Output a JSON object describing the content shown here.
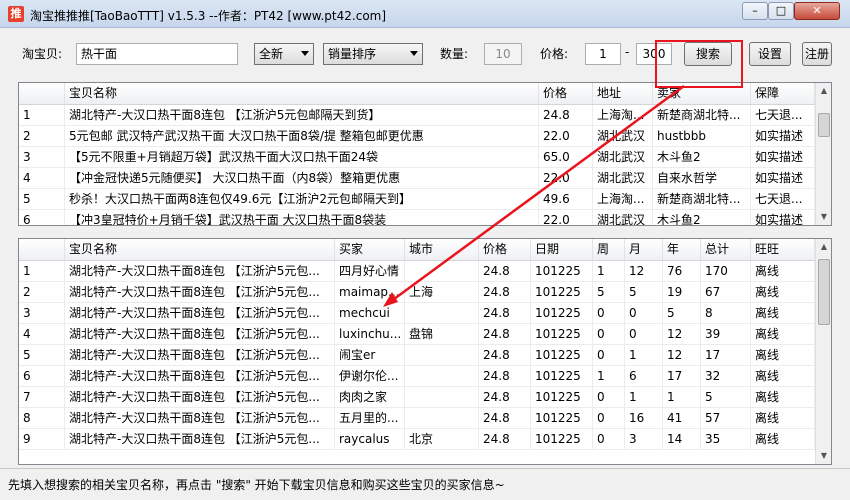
{
  "window": {
    "app_icon_glyph": "推",
    "title": "淘宝推推推[TaoBaoTTT] v1.5.3 --作者：PT42 [www.pt42.com]",
    "minimize_glyph": "–",
    "maximize_glyph": "□",
    "close_glyph": "✕"
  },
  "toolbar": {
    "keyword_label": "淘宝贝:",
    "keyword_value": "热干面",
    "condition_value": "全新",
    "sort_value": "销量排序",
    "count_label": "数量:",
    "count_value": "10",
    "price_label": "价格:",
    "price_min": "1",
    "price_dash": "-",
    "price_max": "300",
    "search_button": "搜索",
    "settings_button": "设置",
    "register_button": "注册"
  },
  "top_table": {
    "columns": [
      "",
      "宝贝名称",
      "价格",
      "地址",
      "卖家",
      "保障"
    ],
    "rows": [
      [
        "1",
        "湖北特产-大汉口热干面8连包 【江浙沪5元包邮隔天到货】",
        "24.8",
        "上海淘...",
        "新楚商湖北特...",
        "七天退..."
      ],
      [
        "2",
        "5元包邮 武汉特产武汉热干面 大汉口热干面8袋/提 整箱包邮更优惠",
        "22.0",
        "湖北武汉",
        "hustbbb",
        "如实描述"
      ],
      [
        "3",
        "【5元不限重+月销超万袋】武汉热干面大汉口热干面24袋",
        "65.0",
        "湖北武汉",
        "木斗鱼2",
        "如实描述"
      ],
      [
        "4",
        "【冲金冠快递5元随便买】 大汉口热干面（内8袋）整箱更优惠",
        "22.0",
        "湖北武汉",
        "自来水哲学",
        "如实描述"
      ],
      [
        "5",
        "秒杀！大汉口热干面两8连包仅49.6元【江浙沪2元包邮隔天到】",
        "49.6",
        "上海淘...",
        "新楚商湖北特...",
        "七天退..."
      ],
      [
        "6",
        "【冲3皇冠特价+月销千袋】武汉热干面 大汉口热干面8袋装",
        "22.0",
        "湖北武汉",
        "木斗鱼2",
        "如实描述"
      ]
    ]
  },
  "bottom_table": {
    "columns": [
      "",
      "宝贝名称",
      "买家",
      "城市",
      "价格",
      "日期",
      "周",
      "月",
      "年",
      "总计",
      "旺旺"
    ],
    "rows": [
      [
        "1",
        "湖北特产-大汉口热干面8连包 【江浙沪5元包...",
        "四月好心情",
        "",
        "24.8",
        "101225",
        "1",
        "12",
        "76",
        "170",
        "离线"
      ],
      [
        "2",
        "湖北特产-大汉口热干面8连包 【江浙沪5元包...",
        "maimap...",
        "上海",
        "24.8",
        "101225",
        "5",
        "5",
        "19",
        "67",
        "离线"
      ],
      [
        "3",
        "湖北特产-大汉口热干面8连包 【江浙沪5元包...",
        "mechcui",
        "",
        "24.8",
        "101225",
        "0",
        "0",
        "5",
        "8",
        "离线"
      ],
      [
        "4",
        "湖北特产-大汉口热干面8连包 【江浙沪5元包...",
        "luxinchu...",
        "盘锦",
        "24.8",
        "101225",
        "0",
        "0",
        "12",
        "39",
        "离线"
      ],
      [
        "5",
        "湖北特产-大汉口热干面8连包 【江浙沪5元包...",
        "闹宝er",
        "",
        "24.8",
        "101225",
        "0",
        "1",
        "12",
        "17",
        "离线"
      ],
      [
        "6",
        "湖北特产-大汉口热干面8连包 【江浙沪5元包...",
        "伊谢尔伦...",
        "",
        "24.8",
        "101225",
        "1",
        "6",
        "17",
        "32",
        "离线"
      ],
      [
        "7",
        "湖北特产-大汉口热干面8连包 【江浙沪5元包...",
        "肉肉之家",
        "",
        "24.8",
        "101225",
        "0",
        "1",
        "1",
        "5",
        "离线"
      ],
      [
        "8",
        "湖北特产-大汉口热干面8连包 【江浙沪5元包...",
        "五月里的...",
        "",
        "24.8",
        "101225",
        "0",
        "16",
        "41",
        "57",
        "离线"
      ],
      [
        "9",
        "湖北特产-大汉口热干面8连包 【江浙沪5元包...",
        "raycalus",
        "北京",
        "24.8",
        "101225",
        "0",
        "3",
        "14",
        "35",
        "离线"
      ]
    ]
  },
  "status": {
    "text": "先填入想搜索的相关宝贝名称，再点击 \"搜索\" 开始下载宝贝信息和购买这些宝贝的买家信息~"
  },
  "colors": {
    "highlight": "#e8141e",
    "titlebar": "#c6d6ec"
  }
}
